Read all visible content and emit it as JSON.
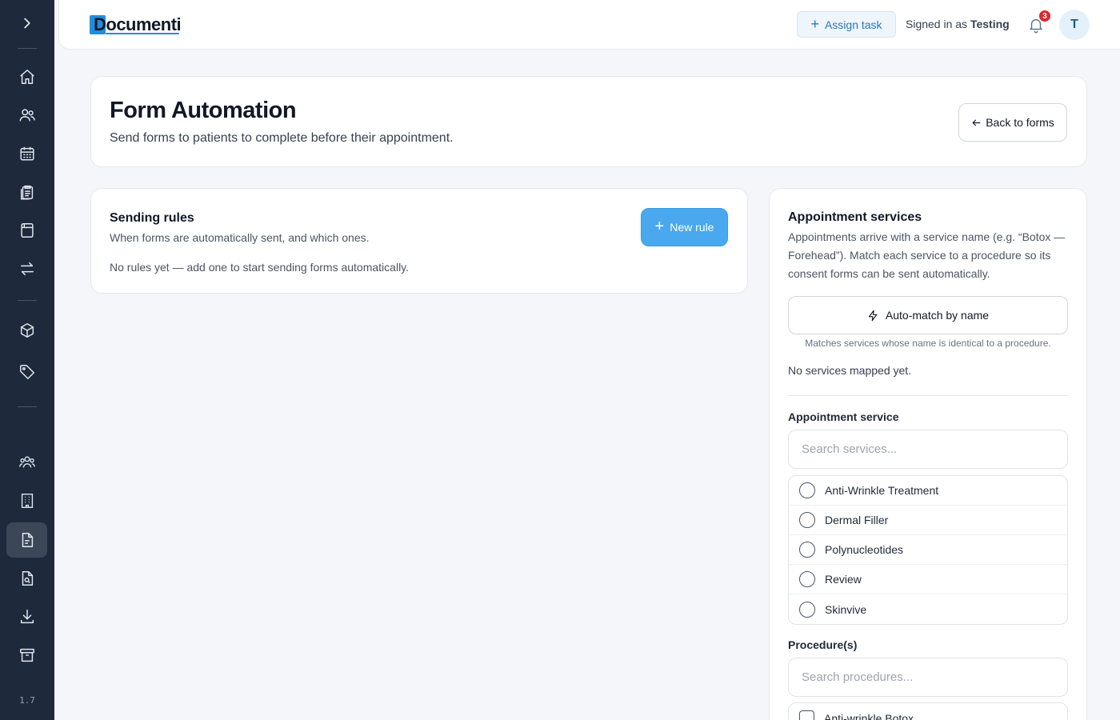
{
  "sidebar": {
    "toggle_icon": "chevron-right-icon",
    "items": [
      {
        "name": "home",
        "icon": "home-icon"
      },
      {
        "name": "patients",
        "icon": "users-icon"
      },
      {
        "name": "calendar",
        "icon": "calendar-icon"
      },
      {
        "name": "clipboard",
        "icon": "clipboard-icon"
      },
      {
        "name": "forms",
        "icon": "document-icon"
      },
      {
        "name": "transfer",
        "icon": "arrows-icon"
      },
      {
        "name": "products",
        "icon": "box-icon"
      },
      {
        "name": "tags",
        "icon": "tag-icon"
      },
      {
        "name": "team",
        "icon": "team-icon"
      },
      {
        "name": "clinics",
        "icon": "building-icon"
      },
      {
        "name": "form-automation",
        "icon": "file-text-icon",
        "active": true
      },
      {
        "name": "search-documents",
        "icon": "file-search-icon"
      },
      {
        "name": "downloads",
        "icon": "download-icon"
      },
      {
        "name": "archive",
        "icon": "archive-icon"
      }
    ],
    "version": "1.7"
  },
  "topbar": {
    "logo_text": "Documenti",
    "assign_task_label": "Assign task",
    "signed_in_prefix": "Signed in as",
    "signed_in_user": "Testing",
    "notification_count": "3",
    "avatar_initial": "T"
  },
  "header": {
    "title": "Form Automation",
    "subtitle": "Send forms to patients to complete before their appointment.",
    "back_label": "Back to forms"
  },
  "sending_rules": {
    "title": "Sending rules",
    "description": "When forms are automatically sent, and which ones.",
    "new_rule_label": "New rule",
    "empty_text": "No rules yet — add one to start sending forms automatically."
  },
  "appointment_services": {
    "title": "Appointment services",
    "description": "Appointments arrive with a service name (e.g. “Botox — Forehead”). Match each service to a procedure so its consent forms can be sent automatically.",
    "automatch_label": "Auto-match by name",
    "automatch_hint": "Matches services whose name is identical to a procedure.",
    "no_mapped_text": "No services mapped yet.",
    "service_label": "Appointment service",
    "service_search_placeholder": "Search services...",
    "services": [
      "Anti-Wrinkle Treatment",
      "Dermal Filler",
      "Polynucleotides",
      "Review",
      "Skinvive"
    ],
    "procedure_label": "Procedure(s)",
    "procedure_search_placeholder": "Search procedures...",
    "procedures": [
      "Anti-wrinkle Botox"
    ]
  },
  "colors": {
    "sidebar_bg": "#1e293b",
    "accent": "#4aa8ee",
    "badge": "#e0262f"
  }
}
